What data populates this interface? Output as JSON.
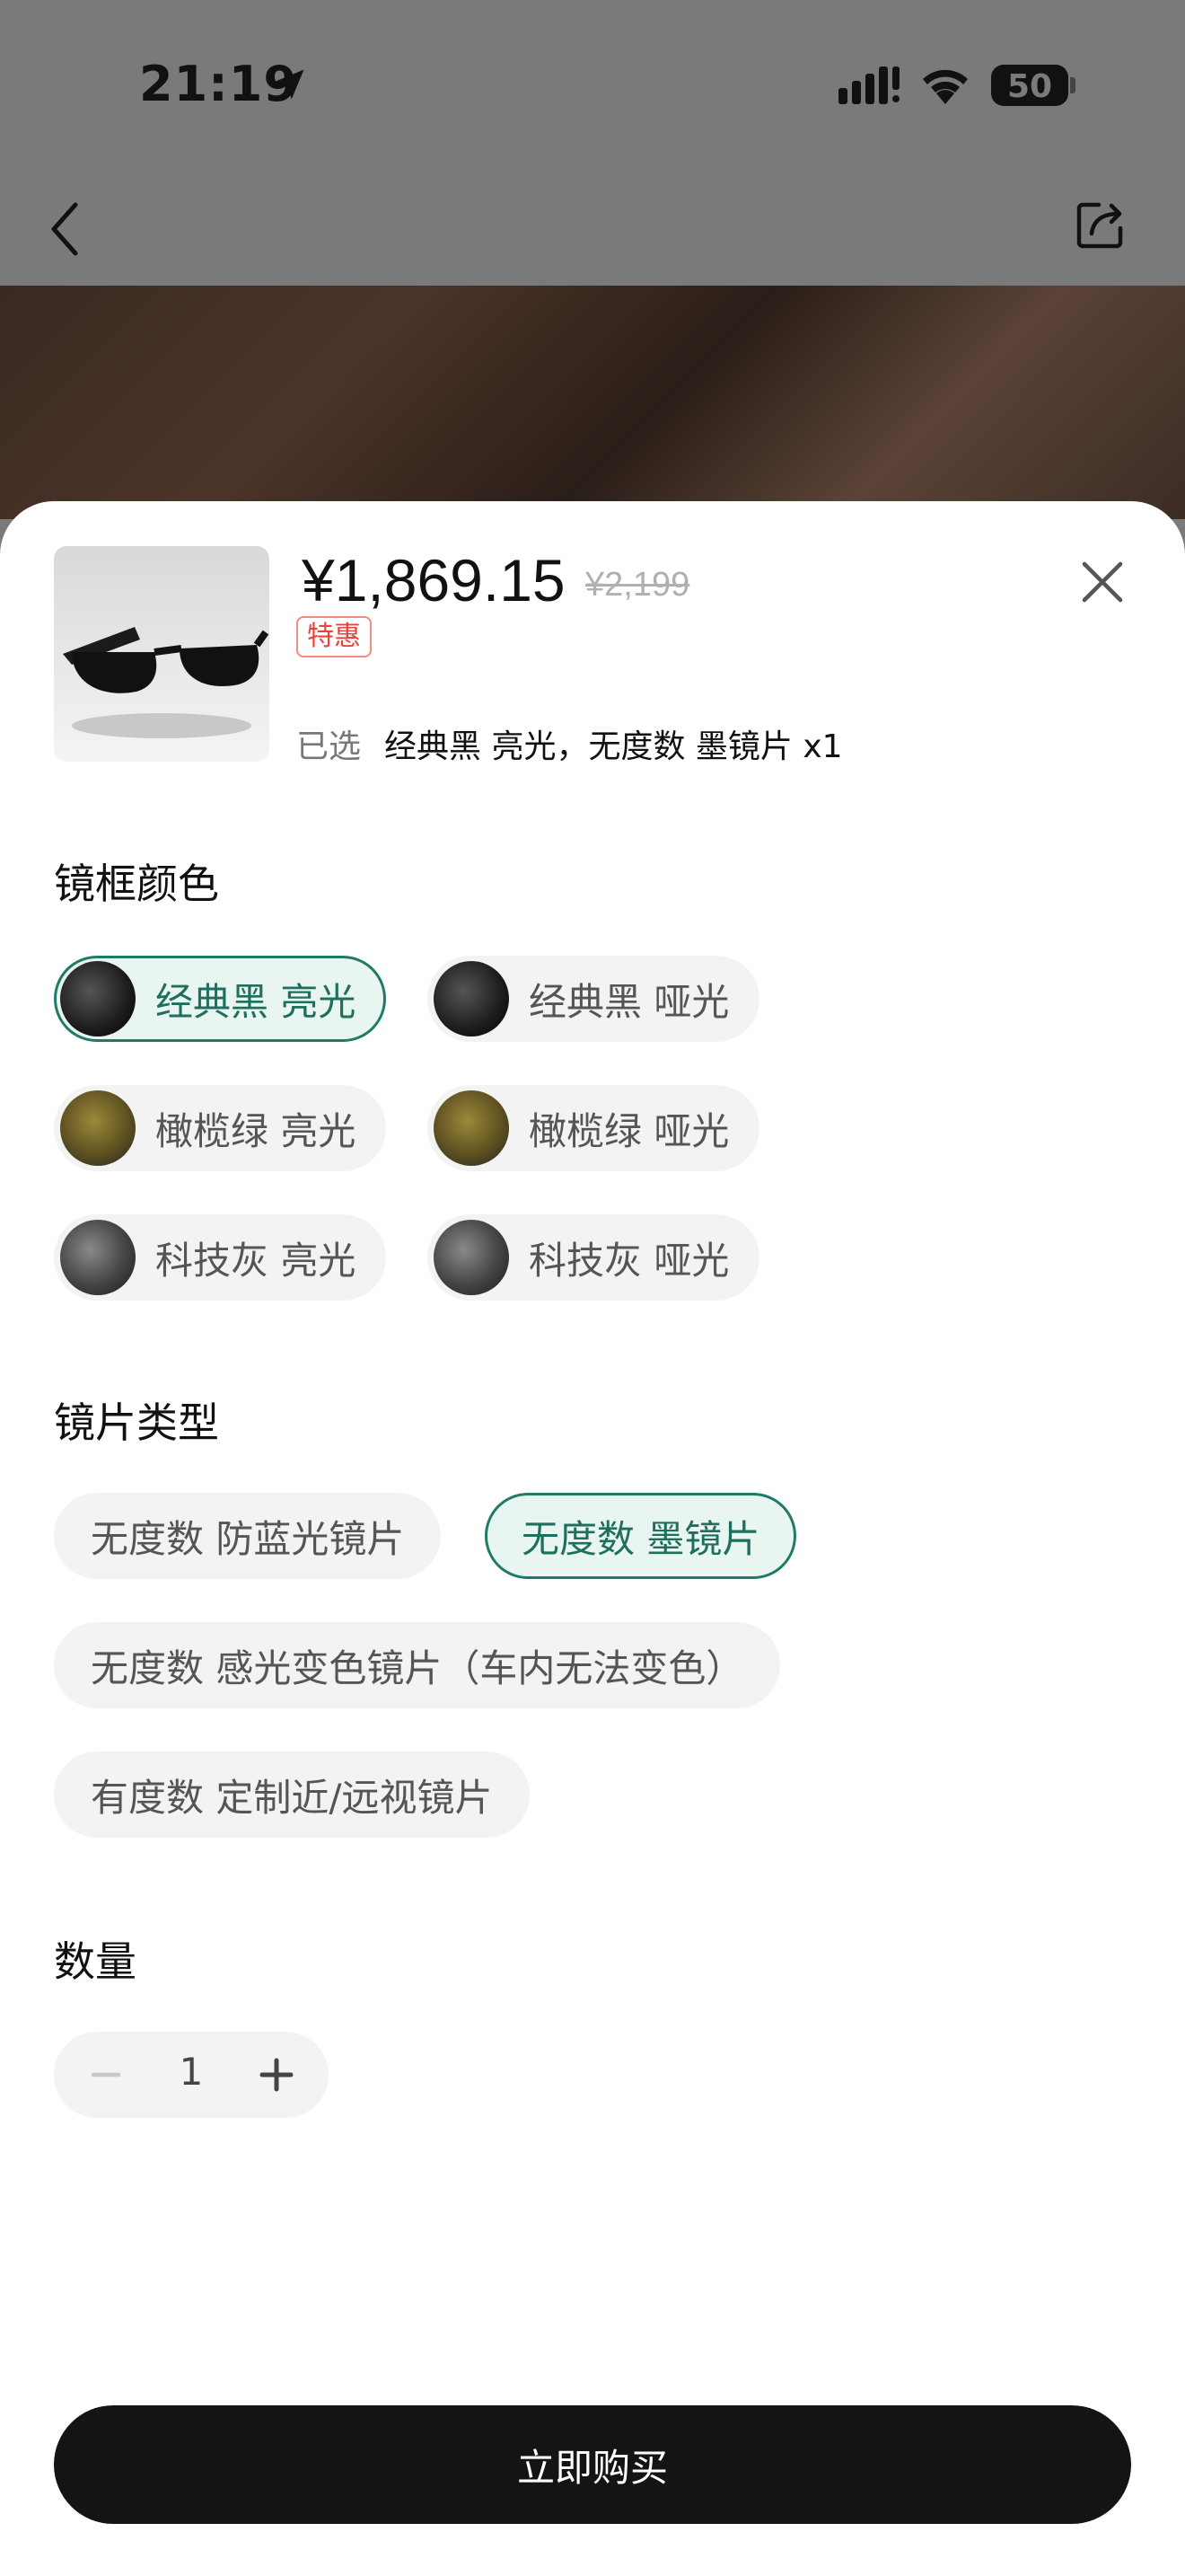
{
  "status_bar": {
    "time": "21:19",
    "battery": "50"
  },
  "product": {
    "price": "¥1,869.15",
    "original_price": "¥2,199",
    "badge": "特惠",
    "selected_label": "已选",
    "selected_value": "经典黑 亮光，无度数 墨镜片 x1"
  },
  "frame_color": {
    "title": "镜框颜色",
    "options": [
      {
        "label": "经典黑 亮光",
        "swatch": "black",
        "selected": true
      },
      {
        "label": "经典黑 哑光",
        "swatch": "black",
        "selected": false
      },
      {
        "label": "橄榄绿 亮光",
        "swatch": "olive",
        "selected": false
      },
      {
        "label": "橄榄绿 哑光",
        "swatch": "olive",
        "selected": false
      },
      {
        "label": "科技灰 亮光",
        "swatch": "gray",
        "selected": false
      },
      {
        "label": "科技灰 哑光",
        "swatch": "gray",
        "selected": false
      }
    ]
  },
  "lens_type": {
    "title": "镜片类型",
    "options": [
      {
        "label": "无度数 防蓝光镜片",
        "selected": false
      },
      {
        "label": "无度数 墨镜片",
        "selected": true
      },
      {
        "label": "无度数 感光变色镜片（车内无法变色）",
        "selected": false
      },
      {
        "label": "有度数 定制近/远视镜片",
        "selected": false
      }
    ]
  },
  "quantity": {
    "title": "数量",
    "value": "1"
  },
  "buy_button": {
    "label": "立即购买"
  },
  "colors": {
    "accent": "#1f7a68",
    "accent_bg": "#e8f5f0",
    "badge": "#e8433c",
    "button": "#141414"
  }
}
